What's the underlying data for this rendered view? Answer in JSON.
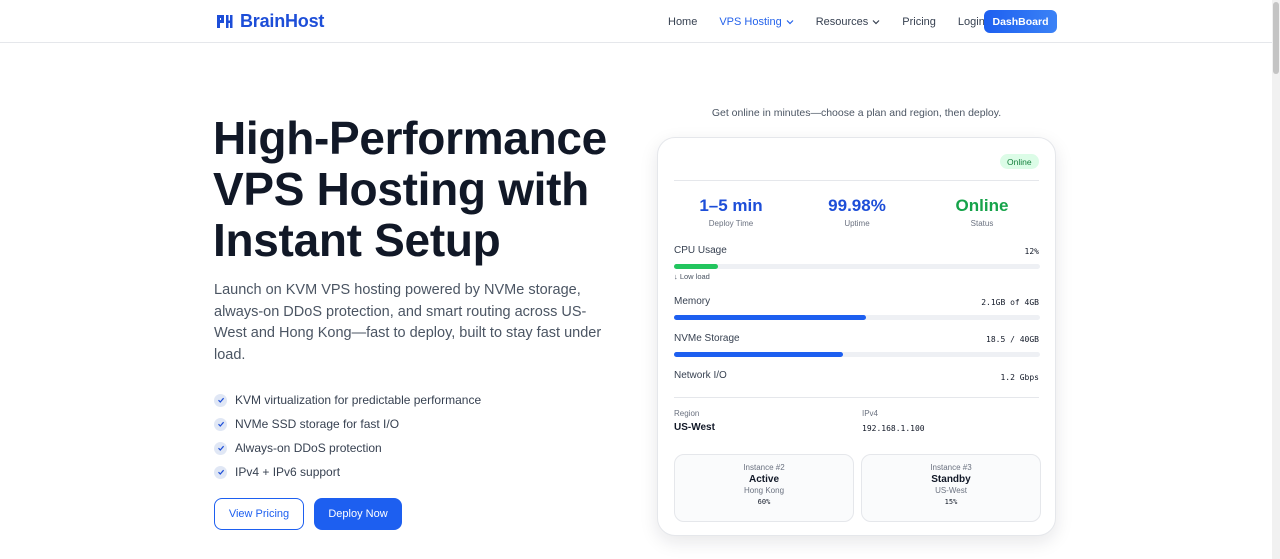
{
  "brand": {
    "name": "BrainHost",
    "accent": "#1d5ff0"
  },
  "nav": {
    "items": [
      {
        "label": "Home",
        "active": false,
        "dropdown": false
      },
      {
        "label": "VPS Hosting",
        "active": true,
        "dropdown": true
      },
      {
        "label": "Resources",
        "active": false,
        "dropdown": true
      },
      {
        "label": "Pricing",
        "active": false,
        "dropdown": false
      },
      {
        "label": "Login",
        "active": false,
        "dropdown": false
      }
    ],
    "dashboard_label": "DashBoard"
  },
  "hero": {
    "title": "High-Performance VPS Hosting with Instant Setup",
    "subtitle": "Launch on KVM VPS hosting powered by NVMe storage, always-on DDoS protection, and smart routing across US-West and Hong Kong—fast to deploy, built to stay fast under load.",
    "features": [
      "KVM virtualization for predictable performance",
      "NVMe SSD storage for fast I/O",
      "Always-on DDoS protection",
      "IPv4 + IPv6 support"
    ],
    "btn_pricing": "View Pricing",
    "btn_deploy": "Deploy Now"
  },
  "card": {
    "caption": "Get online in minutes—choose a plan and region, then deploy.",
    "badge": "Online",
    "stats": [
      {
        "value": "1–5 min",
        "label": "Deploy Time"
      },
      {
        "value": "99.98%",
        "label": "Uptime"
      },
      {
        "value": "Online",
        "label": "Status"
      }
    ],
    "metrics": {
      "cpu": {
        "label": "CPU Usage",
        "value": "12%",
        "fill": 0.12,
        "color": "#22c55e",
        "hint": "↓ Low load"
      },
      "memory": {
        "label": "Memory",
        "value": "2.1GB of 4GB",
        "fill": 0.525,
        "color": "#1d5ff0"
      },
      "storage": {
        "label": "NVMe Storage",
        "value": "18.5 / 40GB",
        "fill": 0.4625,
        "color": "#1d5ff0"
      },
      "network": {
        "label": "Network I/O",
        "value": "1.2 Gbps"
      }
    },
    "region": {
      "label": "Region",
      "value": "US-West"
    },
    "ipv4": {
      "label": "IPv4",
      "value": "192.168.1.100"
    },
    "instances": [
      {
        "num": "Instance #2",
        "status": "Active",
        "region": "Hong Kong",
        "pct": "60%"
      },
      {
        "num": "Instance #3",
        "status": "Standby",
        "region": "US-West",
        "pct": "15%"
      }
    ]
  }
}
